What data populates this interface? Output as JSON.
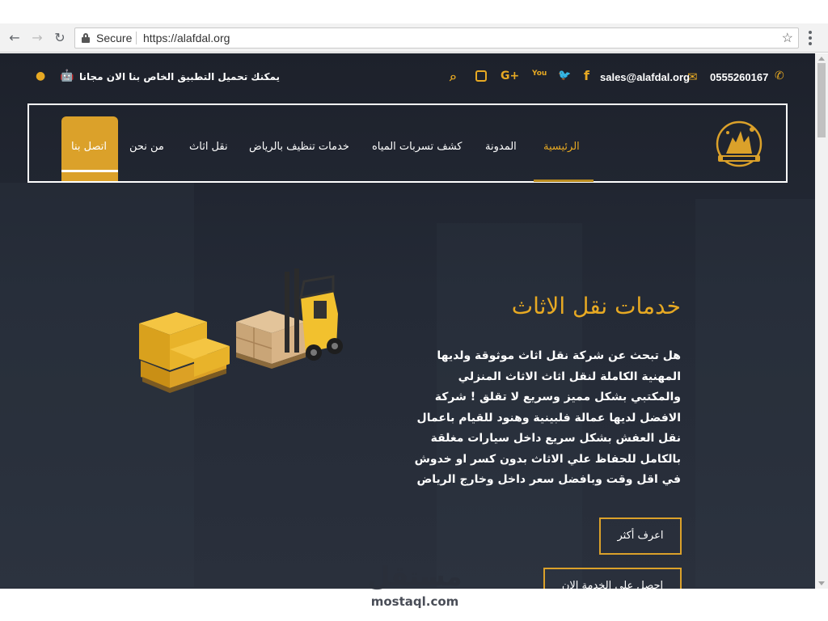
{
  "browser": {
    "secure_label": "Secure",
    "url": "https://alafdal.org"
  },
  "topbar": {
    "phone": "0555260167",
    "email": "sales@alafdal.org",
    "app_promo": "يمكنك تحميل التطبيق الخاص بنا الان مجانا",
    "social_icons": [
      "facebook-icon",
      "twitter-icon",
      "youtube-icon",
      "google-plus-icon",
      "instagram-icon",
      "search-icon"
    ],
    "google_plus_label": "G+",
    "youtube_label": "You"
  },
  "nav": {
    "items": [
      {
        "label": "الرئيسية",
        "active": true
      },
      {
        "label": "المدونة"
      },
      {
        "label": "كشف تسربات المياه"
      },
      {
        "label": "خدمات تنظيف بالرياض"
      },
      {
        "label": "نقل اثاث"
      },
      {
        "label": "من نحن"
      },
      {
        "label": "اتصل بنا"
      }
    ]
  },
  "hero": {
    "title": "خدمات نقل الاثاث",
    "body": "هل تبحث عن شركة نقل اثاث موثوقة ولديها المهنية الكاملة لنقل اثاث الاثاث المنزلي والمكتبي بشكل مميز وسريع لا تقلق ! شركة الافضل لديها عمالة فلبينية وهنود للقيام باعمال نقل العفش بشكل سريع داخل سيارات مغلقة بالكامل للحفاظ علي الاثاث بدون كسر او خدوش في اقل وقت وبافضل سعر داخل وخارج الرياض",
    "btn_more": "اعرف أكثر",
    "btn_service": "احصل علي الخدمة الان"
  },
  "watermark": {
    "logo": "مستقل",
    "text": "mostaql.com"
  },
  "colors": {
    "accent": "#e7a923",
    "page_bg": "#1d212b"
  }
}
